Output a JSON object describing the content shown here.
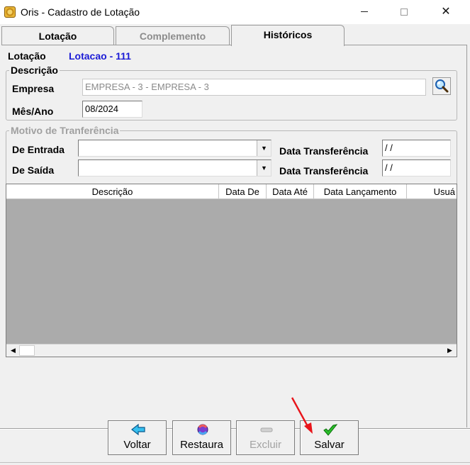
{
  "window": {
    "title": "Oris - Cadastro de Lotação",
    "minimize": "—",
    "maximize": "☐",
    "close": "✕"
  },
  "tabs": [
    {
      "label": "Lotação"
    },
    {
      "label": "Complemento"
    },
    {
      "label": "Históricos"
    }
  ],
  "header": {
    "lotacao_label": "Lotação",
    "lotacao_value": "Lotacao - 111"
  },
  "descricao": {
    "legend": "Descrição",
    "empresa_label": "Empresa",
    "empresa_value": "EMPRESA - 3 - EMPRESA - 3",
    "mes_ano_label": "Mês/Ano",
    "mes_ano_value": "08/2024"
  },
  "motivo": {
    "legend": "Motivo de Tranferência",
    "entrada_label": "De Entrada",
    "saida_label": "De Saída",
    "data_transf_label": "Data Transferência",
    "data_entrada_value": " / /",
    "data_saida_value": " / /"
  },
  "grid": {
    "columns": [
      "Descrição",
      "Data De",
      "Data Até",
      "Data Lançamento",
      "Usuá"
    ],
    "rows": []
  },
  "buttons": {
    "voltar": "Voltar",
    "restaura": "Restaura",
    "excluir": "Excluir",
    "salvar": "Salvar"
  },
  "colors": {
    "accent_blue": "#1b1bd6",
    "annotation_red": "#e8141a",
    "grid_background": "#ababab"
  }
}
